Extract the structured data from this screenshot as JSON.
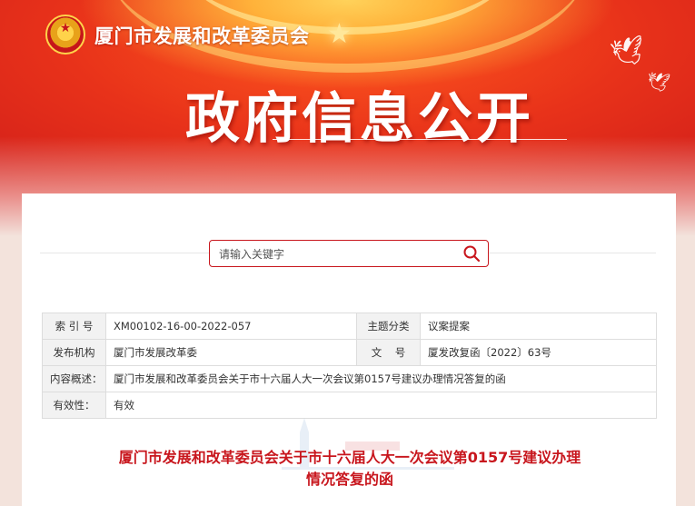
{
  "header": {
    "site_name": "厦门市发展和改革委员会",
    "page_title": "政府信息公开"
  },
  "search": {
    "placeholder": "请输入关键字"
  },
  "meta": {
    "rows": [
      {
        "label1": "索 引 号",
        "value1": "XM00102-16-00-2022-057",
        "label2": "主题分类",
        "value2": "议案提案"
      },
      {
        "label1": "发布机构",
        "value1": "厦门市发展改革委",
        "label2": "文    号",
        "value2": "厦发改复函〔2022〕63号"
      },
      {
        "label1": "内容概述：",
        "value1": "厦门市发展和改革委员会关于市十六届人大一次会议第0157号建议办理情况答复的函"
      },
      {
        "label1": "有效性：",
        "value1": "有效"
      }
    ]
  },
  "document": {
    "title_line1": "厦门市发展和改革委员会关于市十六届人大一次会议第0157号建议办理",
    "title_line2": "情况答复的函"
  },
  "colors": {
    "brand_red": "#c8161d",
    "banner_red": "#e8321a",
    "label_bg": "#f2f2f2"
  }
}
